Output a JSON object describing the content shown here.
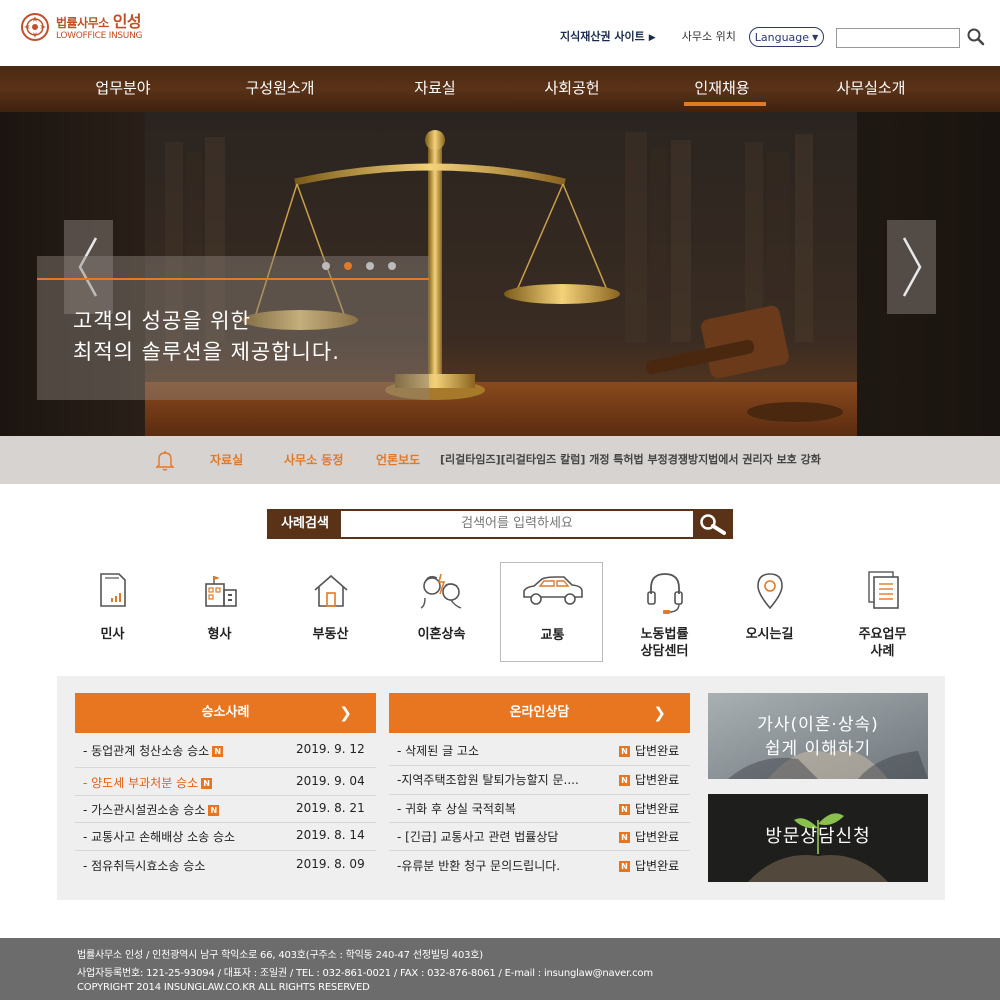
{
  "colors": {
    "brand_brown": "#5a3218",
    "accent_orange": "#e8751f",
    "footer_gray": "#6d6c6c",
    "ticker_gray": "#d6d3d1"
  },
  "header": {
    "logo_line1": "법률사무소",
    "logo_name": "인성",
    "logo_line2": "LOWOFFICE INSUNG",
    "ip_link": "지식재산권 사이트",
    "location_link": "사무소 위치",
    "language_label": "Language",
    "search_value": ""
  },
  "nav": {
    "items": [
      "업무분야",
      "구성원소개",
      "자료실",
      "사회공헌",
      "인재채용",
      "사무실소개"
    ],
    "active_index": 4
  },
  "hero": {
    "caption_line1": "고객의 성공을 위한",
    "caption_line2": "최적의 솔루션을 제공합니다.",
    "slide_count": 4,
    "active_slide": 1
  },
  "ticker": {
    "tab1": "자료실",
    "tab2": "사무소 동정",
    "tab3": "언론보도",
    "headline": "[리걸타임즈][리걸타임즈 칼럼] 개정 특허법 부정경쟁방지법에서 권리자 보호 강화"
  },
  "case_search": {
    "label": "사례검색",
    "placeholder": "검색어를 입력하세요"
  },
  "categories": [
    {
      "line1": "민사",
      "line2": ""
    },
    {
      "line1": "형사",
      "line2": ""
    },
    {
      "line1": "부동산",
      "line2": ""
    },
    {
      "line1": "이혼상속",
      "line2": ""
    },
    {
      "line1": "교통",
      "line2": ""
    },
    {
      "line1": "노동법률",
      "line2": "상담센터"
    },
    {
      "line1": "오시는길",
      "line2": ""
    },
    {
      "line1": "주요업무",
      "line2": "사례"
    }
  ],
  "wins": {
    "title": "승소사례",
    "items": [
      {
        "title": "- 동업관계 청산소송 승소",
        "date": "2019. 9. 12"
      },
      {
        "title": "- 양도세 부과처분 승소",
        "date": "2019. 9. 04"
      },
      {
        "title": "- 가스관시설권소송 승소",
        "date": "2019. 8. 21"
      },
      {
        "title": "- 교통사고 손해배상 소송 승소",
        "date": "2019. 8. 14"
      },
      {
        "title": "- 점유취득시효소송 승소",
        "date": "2019. 8. 09"
      }
    ]
  },
  "consult": {
    "title": "온라인상담",
    "status": "답변완료",
    "items": [
      {
        "title": "- 삭제된 글 고소"
      },
      {
        "title": "-지역주택조합원 탈퇴가능할지 문...."
      },
      {
        "title": "- 귀화 후 상실 국적회복"
      },
      {
        "title": "- [긴급] 교통사고 관련 법률상담"
      },
      {
        "title": "-유류분 반환 청구 문의드립니다."
      }
    ]
  },
  "new_badge": "N",
  "promo": {
    "family_line1": "가사(이혼·상속)",
    "family_line2": "쉽게 이해하기",
    "visit": "방문상담신청"
  },
  "footer": {
    "line1": "법률사무소 인성 / 인천광역시 남구 학익소로 66, 403호(구주소 : 학익동 240-47 선정빌딩 403호)",
    "line2": "사업자등록번호: 121-25-93094  /  대표자 : 조일권  /  TEL : 032-861-0021  /  FAX : 032-876-8061 / E-mail : insunglaw@naver.com",
    "line3": "COPYRIGHT 2014 INSUNGLAW.CO.KR ALL RIGHTS RESERVED"
  }
}
